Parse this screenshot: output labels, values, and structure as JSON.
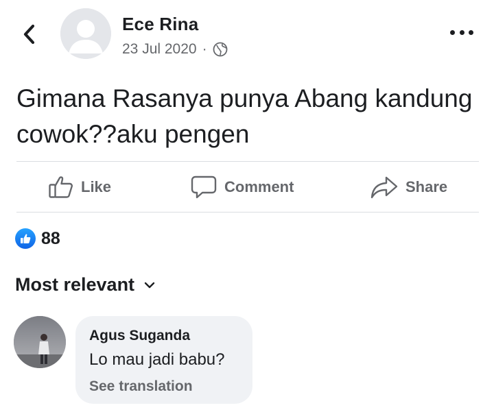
{
  "post": {
    "author": "Ece Rina",
    "date": "23 Jul 2020",
    "separator": "·",
    "privacy_icon": "globe-icon",
    "text": "Gimana Rasanya punya Abang kandung cowok??aku pengen"
  },
  "actions": {
    "like_label": "Like",
    "comment_label": "Comment",
    "share_label": "Share"
  },
  "reactions": {
    "type": "like",
    "count": "88"
  },
  "comments_sort": {
    "label": "Most relevant"
  },
  "comments": [
    {
      "author": "Agus Suganda",
      "text": "Lo mau jadi babu?",
      "translate_label": "See translation"
    }
  ],
  "colors": {
    "text_primary": "#1c1e21",
    "text_secondary": "#65676b",
    "like_blue": "#1877f2",
    "bubble_bg": "#f0f2f5",
    "divider": "#dadde1"
  }
}
